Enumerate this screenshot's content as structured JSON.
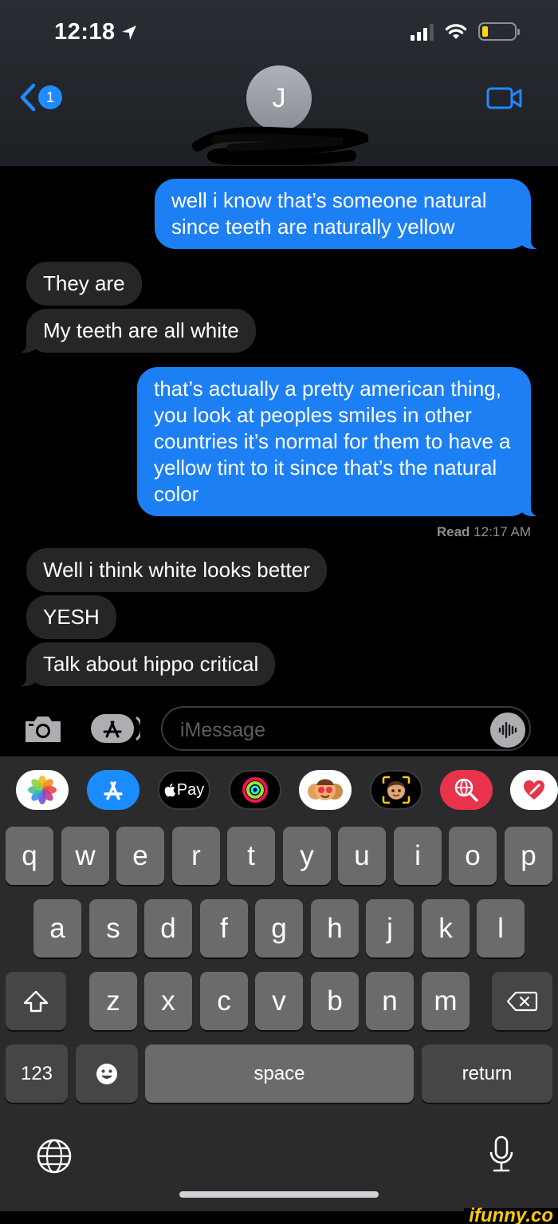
{
  "status_bar": {
    "time": "12:18"
  },
  "header": {
    "back_count": "1",
    "contact_initial": "J"
  },
  "messages": [
    {
      "from": "me",
      "text": "well i know that’s someone natural since teeth are naturally yellow"
    },
    {
      "from": "them",
      "text": "They are"
    },
    {
      "from": "them",
      "text": "My teeth are all white"
    },
    {
      "from": "me",
      "text": "that’s actually a pretty american thing, you look at peoples smiles in other countries it’s normal for them to have a yellow tint to it since that’s the natural color"
    },
    {
      "from": "them",
      "text": "Well i think white looks better"
    },
    {
      "from": "them",
      "text": "YESH"
    },
    {
      "from": "them",
      "text": "Talk about hippo critical"
    }
  ],
  "read_receipt": {
    "label": "Read",
    "time": "12:17 AM"
  },
  "composer": {
    "placeholder": "iMessage"
  },
  "app_strip": {
    "apple_pay_label": "Pay"
  },
  "keyboard": {
    "row1": [
      "q",
      "w",
      "e",
      "r",
      "t",
      "y",
      "u",
      "i",
      "o",
      "p"
    ],
    "row2": [
      "a",
      "s",
      "d",
      "f",
      "g",
      "h",
      "j",
      "k",
      "l"
    ],
    "row3": [
      "z",
      "x",
      "c",
      "v",
      "b",
      "n",
      "m"
    ],
    "numbers_label": "123",
    "space_label": "space",
    "return_label": "return"
  },
  "watermark": "ifunny.co"
}
